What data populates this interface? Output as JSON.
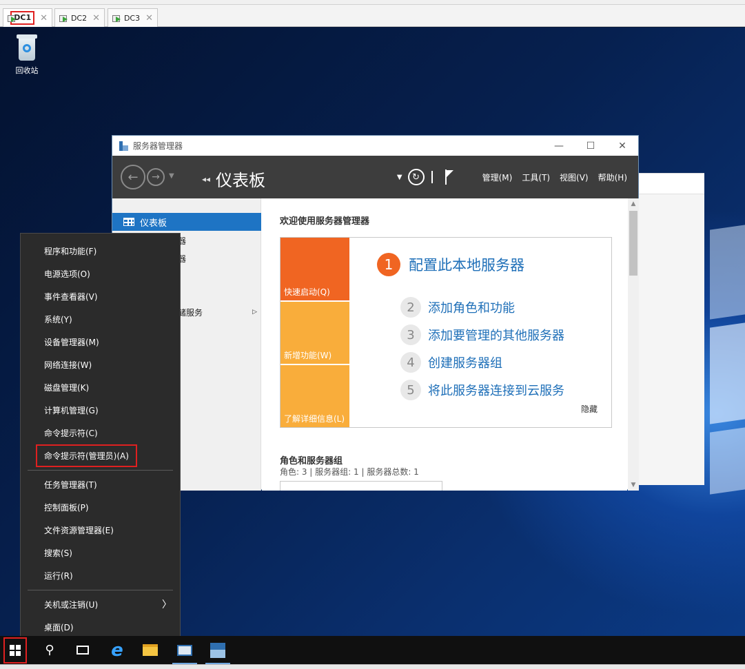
{
  "host_tabs": [
    {
      "label": "DC1",
      "active": true
    },
    {
      "label": "DC2",
      "active": false
    },
    {
      "label": "DC3",
      "active": false
    }
  ],
  "desktop": {
    "recycle_bin_label": "回收站"
  },
  "server_manager": {
    "window_title": "服务器管理器",
    "window_controls": {
      "minimize": "—",
      "maximize": "☐",
      "close": "✕"
    },
    "breadcrumb": "仪表板",
    "menus": [
      "管理(M)",
      "工具(T)",
      "视图(V)",
      "帮助(H)"
    ],
    "sidebar": [
      {
        "label": "仪表板",
        "selected": true
      },
      {
        "label": "器",
        "selected": false
      },
      {
        "label": "器",
        "selected": false
      },
      {
        "label": "储服务",
        "selected": false,
        "has_arrow": true
      }
    ],
    "welcome_title": "欢迎使用服务器管理器",
    "quick_tiles": [
      "快速启动(Q)",
      "新增功能(W)",
      "了解详细信息(L)"
    ],
    "steps": [
      {
        "num": "1",
        "text": "配置此本地服务器"
      },
      {
        "num": "2",
        "text": "添加角色和功能"
      },
      {
        "num": "3",
        "text": "添加要管理的其他服务器"
      },
      {
        "num": "4",
        "text": "创建服务器组"
      },
      {
        "num": "5",
        "text": "将此服务器连接到云服务"
      }
    ],
    "hide_label": "隐藏",
    "roles_title": "角色和服务器组",
    "roles_summary": "角色: 3 | 服务器组: 1 | 服务器总数: 1"
  },
  "context_menu": {
    "group1": [
      "程序和功能(F)",
      "电源选项(O)",
      "事件查看器(V)",
      "系统(Y)",
      "设备管理器(M)",
      "网络连接(W)",
      "磁盘管理(K)",
      "计算机管理(G)",
      "命令提示符(C)",
      "命令提示符(管理员)(A)"
    ],
    "group2": [
      "任务管理器(T)",
      "控制面板(P)",
      "文件资源管理器(E)",
      "搜索(S)",
      "运行(R)"
    ],
    "group3": [
      "关机或注销(U)",
      "桌面(D)"
    ],
    "highlighted": "命令提示符(管理员)(A)"
  },
  "colors": {
    "accent_blue": "#1e74c4",
    "orange": "#f06522",
    "amber": "#f9ad3b",
    "highlight_red": "#e02020"
  }
}
